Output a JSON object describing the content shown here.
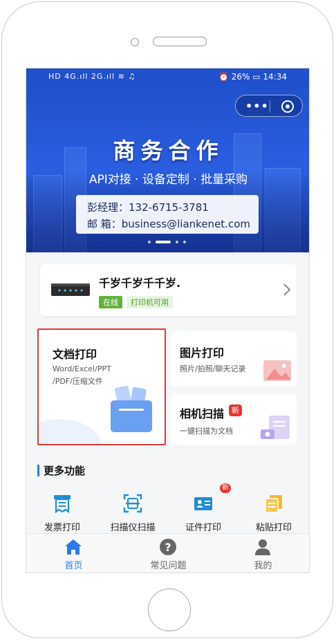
{
  "status_bar": {
    "left": "HD 4G.ıll 2G.ıll ≋ ♫",
    "right": "⏰ 26% ▭ 14:34"
  },
  "capsule": {
    "more_label": "•••"
  },
  "banner": {
    "title": "商务合作",
    "subtitle": "API对接 · 设备定制 · 批量采购",
    "contact_line1": "彭经理：132-6715-3781",
    "contact_line2": "邮    箱：business@liankenet.com"
  },
  "printer": {
    "name": "千岁千岁千千岁.",
    "tag_online": "在线",
    "tag_status": "打印机可用"
  },
  "features": {
    "doc": {
      "title": "文档打印",
      "desc_line1": "Word/Excel/PPT",
      "desc_line2": "/PDF/压缩文件"
    },
    "image": {
      "title": "图片打印",
      "desc": "照片/拍照/聊天记录"
    },
    "scan": {
      "title": "相机扫描",
      "badge": "新",
      "desc": "一键扫描为文档"
    }
  },
  "more": {
    "title": "更多功能",
    "items": [
      {
        "label": "发票打印",
        "icon": "invoice-icon"
      },
      {
        "label": "扫描仪扫描",
        "icon": "scanner-icon"
      },
      {
        "label": "证件打印",
        "icon": "id-card-icon",
        "badge": "新"
      },
      {
        "label": "粘贴打印",
        "icon": "paste-icon"
      }
    ]
  },
  "tabbar": {
    "items": [
      {
        "label": "首页",
        "icon": "home-icon",
        "active": true
      },
      {
        "label": "常见问题",
        "icon": "question-icon"
      },
      {
        "label": "我的",
        "icon": "user-icon"
      }
    ]
  },
  "colors": {
    "accent": "#2a7be4",
    "banner": "#2a5ee0",
    "online": "#63b33a",
    "badge": "#e8332e",
    "highlight": "#e03a3a"
  }
}
